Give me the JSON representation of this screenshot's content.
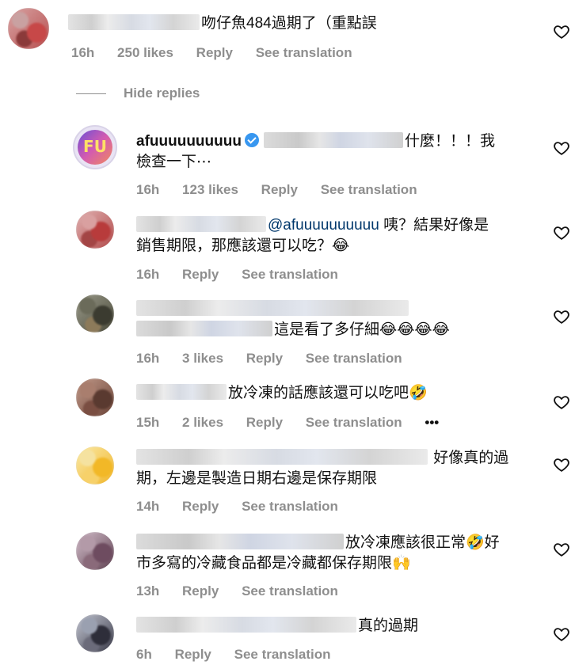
{
  "comments": [
    {
      "text": "吻仔魚484過期了（重點誤",
      "time": "16h",
      "likes": "250 likes",
      "reply": "Reply",
      "translate": "See translation"
    },
    {
      "hide_replies": "Hide replies"
    },
    {
      "avatar_text": "FU",
      "username": "afuuuuuuuuuu",
      "text_line1": "什麼！！！我",
      "text_line2": "檢查一下⋯",
      "time": "16h",
      "likes": "123 likes",
      "reply": "Reply",
      "translate": "See translation"
    },
    {
      "mention": "@afuuuuuuuuuu",
      "text_line1": " 咦？結果好像是",
      "text_line2": "銷售期限，那應該還可以吃？😂",
      "time": "16h",
      "reply": "Reply",
      "translate": "See translation"
    },
    {
      "text_line2": "這是看了多仔細😂😂😂😂",
      "time": "16h",
      "likes": "3 likes",
      "reply": "Reply",
      "translate": "See translation"
    },
    {
      "text": "放冷凍的話應該還可以吃吧🤣",
      "time": "15h",
      "likes": "2 likes",
      "reply": "Reply",
      "translate": "See translation",
      "more": "•••"
    },
    {
      "text_line1": " 好像真的過",
      "text_line2": "期，左邊是製造日期右邊是保存期限",
      "time": "14h",
      "reply": "Reply",
      "translate": "See translation"
    },
    {
      "text_line1": "放冷凍應該很正常🤣好",
      "text_line2": "市多寫的冷藏食品都是冷藏都保存期限🙌",
      "time": "13h",
      "reply": "Reply",
      "translate": "See translation"
    },
    {
      "text": "真的過期",
      "time": "6h",
      "reply": "Reply",
      "translate": "See translation"
    }
  ],
  "icons": {
    "like": "heart-outline-icon",
    "verified": "verified-badge-icon"
  },
  "colors": {
    "meta": "#8e8e8e",
    "mention": "#00376b",
    "verified": "#3897f0"
  }
}
